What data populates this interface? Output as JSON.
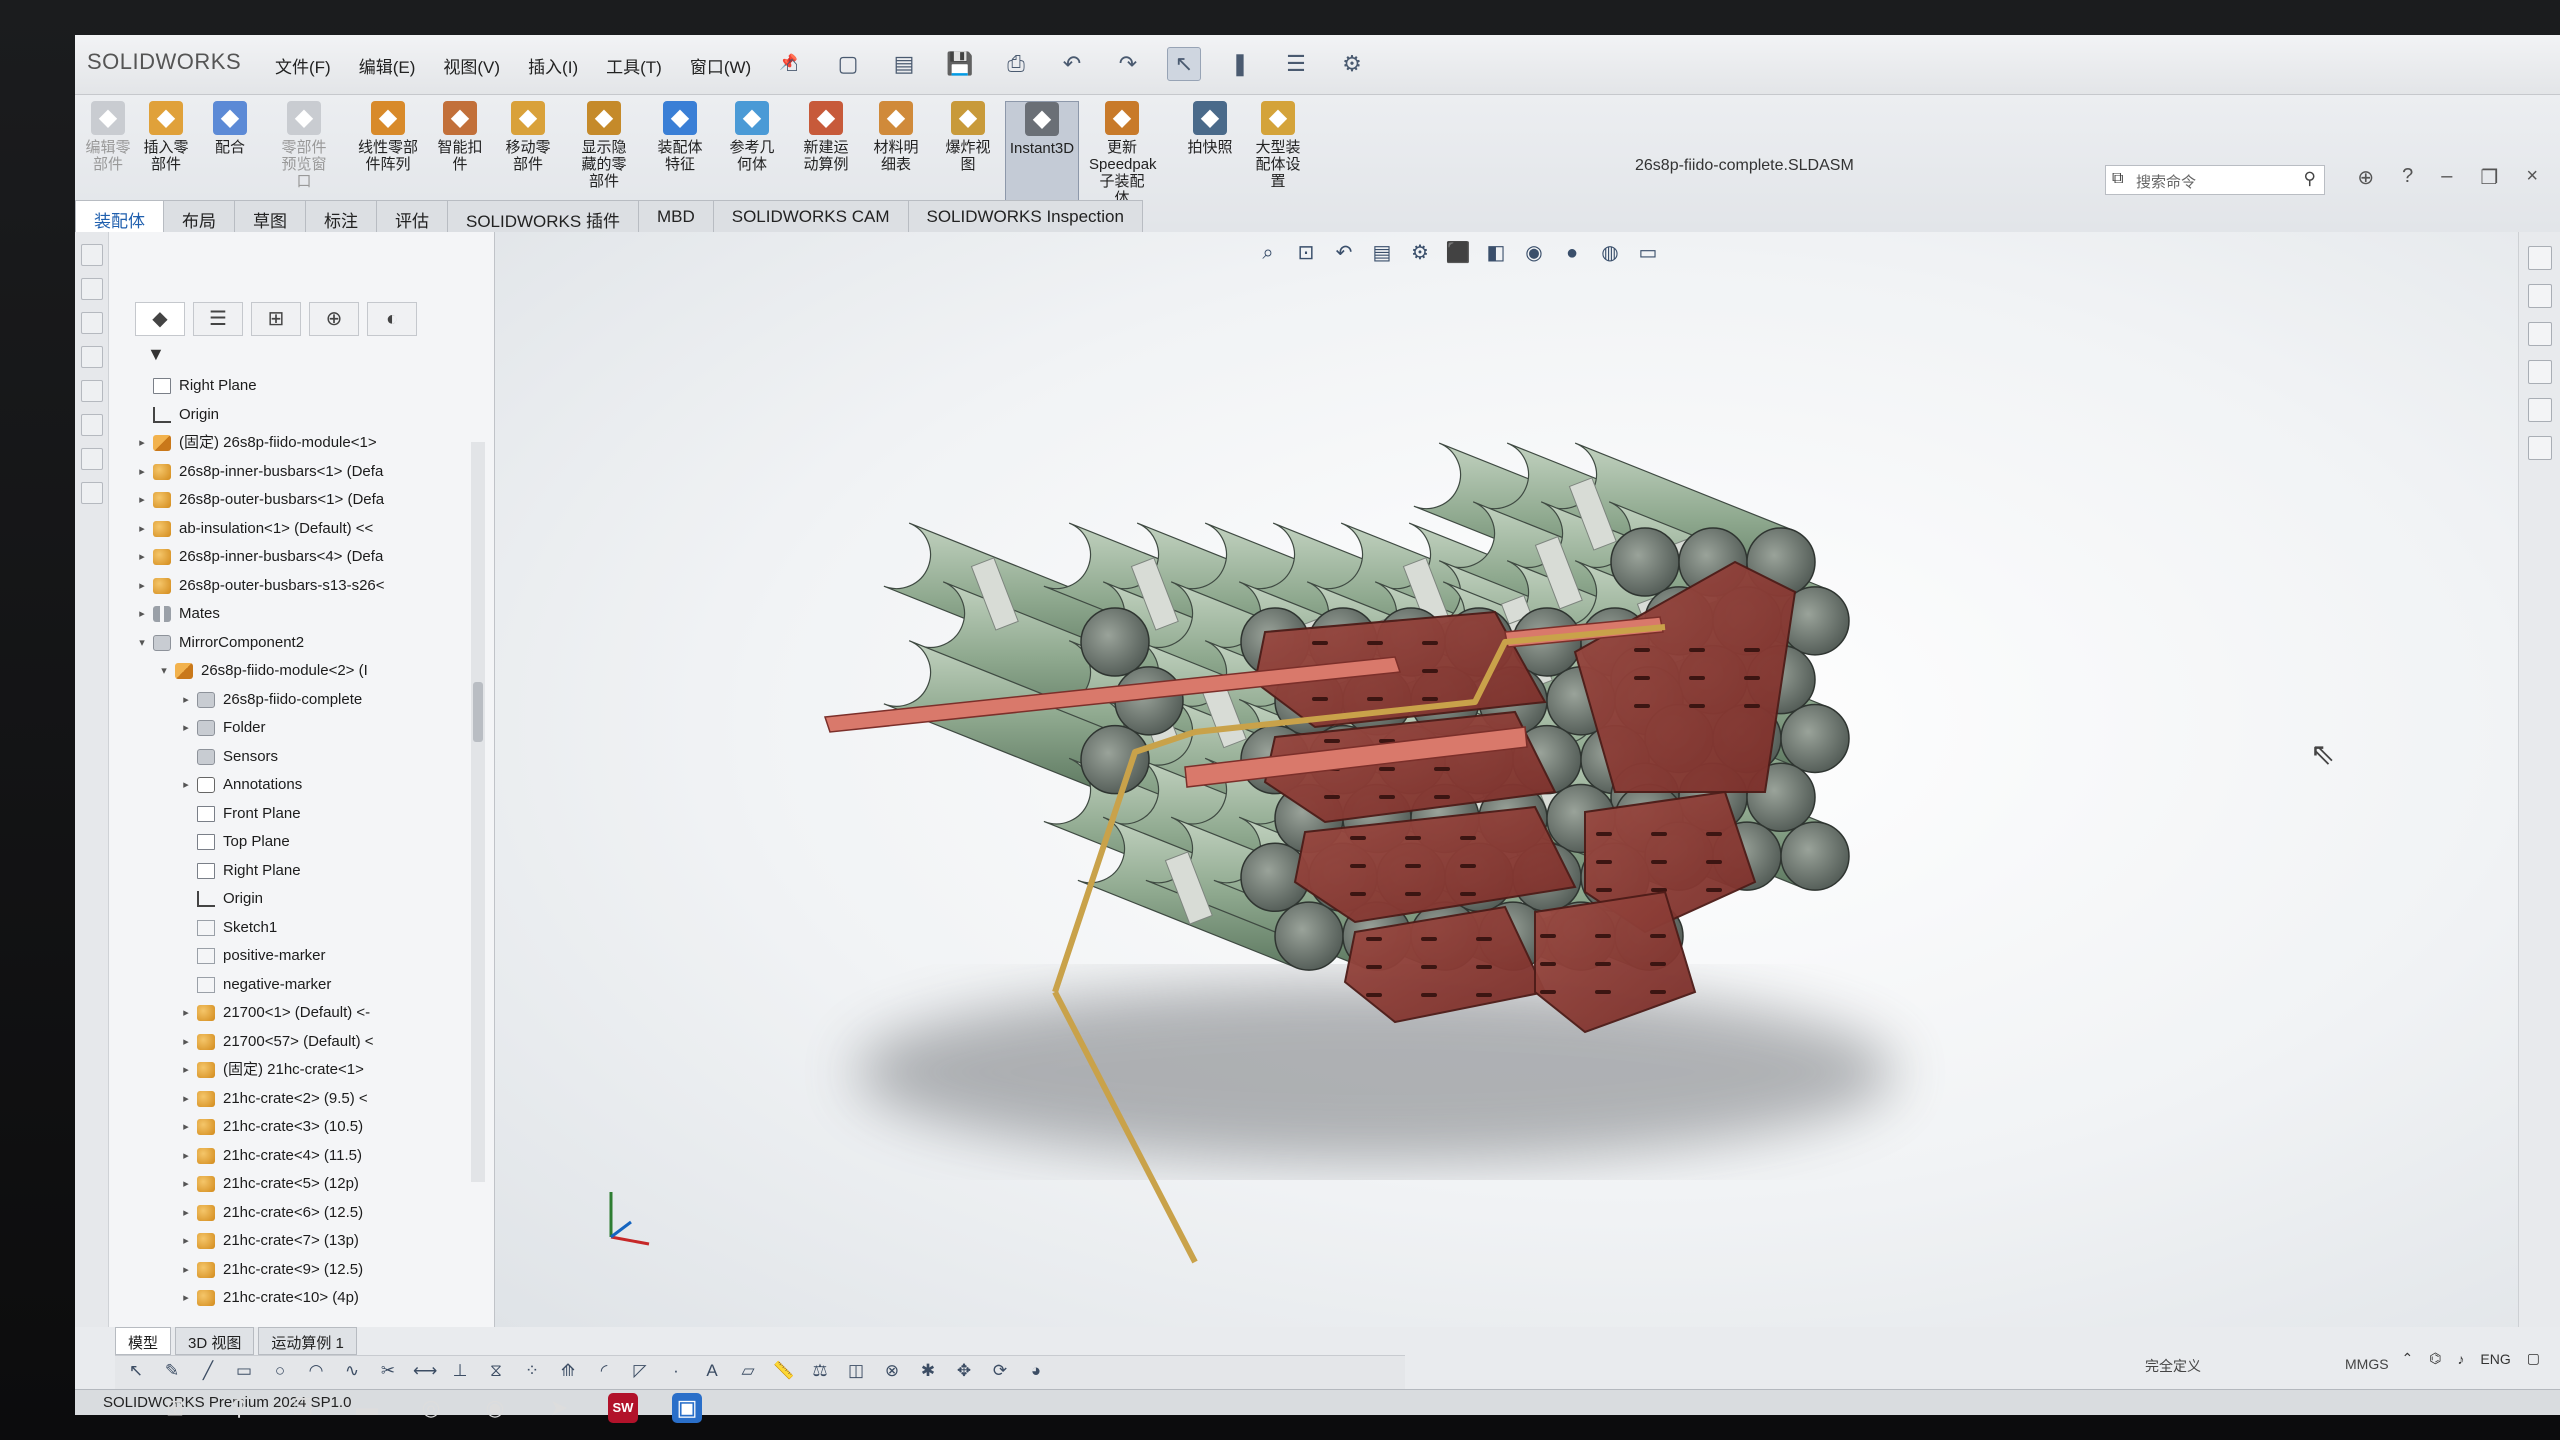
{
  "app": {
    "logo": "SOLIDWORKS",
    "document_title": "26s8p-fiido-complete.SLDASM",
    "version_text": "SOLIDWORKS Premium 2024 SP1.0"
  },
  "menu": [
    "文件(F)",
    "编辑(E)",
    "视图(V)",
    "插入(I)",
    "工具(T)",
    "窗口(W)"
  ],
  "quick_access": [
    "home-icon",
    "new-icon",
    "open-icon",
    "save-icon",
    "print-icon",
    "undo-icon",
    "redo-icon",
    "select-icon",
    "rebuild-icon",
    "file-properties-icon",
    "options-icon"
  ],
  "search": {
    "placeholder": "搜索命令"
  },
  "commands": [
    {
      "label": "编辑零\n部件",
      "dim": true
    },
    {
      "label": "插入零\n部件",
      "dim": false
    },
    {
      "label": "配合",
      "dim": false
    },
    {
      "label": "零部件\n预览窗\n口",
      "dim": true
    },
    {
      "label": "线性零部\n件阵列",
      "dim": false
    },
    {
      "label": "智能扣\n件",
      "dim": false
    },
    {
      "label": "移动零\n部件",
      "dim": false
    },
    {
      "label": "显示隐\n藏的零\n部件",
      "dim": false
    },
    {
      "label": "装配体\n特征",
      "dim": false
    },
    {
      "label": "参考几\n何体",
      "dim": false
    },
    {
      "label": "新建运\n动算例",
      "dim": false
    },
    {
      "label": "材料明\n细表",
      "dim": false
    },
    {
      "label": "爆炸视\n图",
      "dim": false
    },
    {
      "label": "Instant3D",
      "dim": false,
      "active": true
    },
    {
      "label": "更新\nSpeedpak\n子装配\n体",
      "dim": false
    },
    {
      "label": "拍快照",
      "dim": false
    },
    {
      "label": "大型装\n配体设\n置",
      "dim": false
    }
  ],
  "tabs": [
    "装配体",
    "布局",
    "草图",
    "标注",
    "评估",
    "SOLIDWORKS 插件",
    "MBD",
    "SOLIDWORKS CAM",
    "SOLIDWORKS Inspection"
  ],
  "tree": [
    {
      "label": "Right Plane",
      "icon": "plane",
      "level": 0,
      "exp": ""
    },
    {
      "label": "Origin",
      "icon": "origin",
      "level": 0,
      "exp": ""
    },
    {
      "label": "(固定) 26s8p-fiido-module<1>",
      "icon": "asm",
      "level": 0,
      "exp": "▸"
    },
    {
      "label": "26s8p-inner-busbars<1> (Defa",
      "icon": "part",
      "level": 0,
      "exp": "▸"
    },
    {
      "label": "26s8p-outer-busbars<1> (Defa",
      "icon": "part",
      "level": 0,
      "exp": "▸"
    },
    {
      "label": "ab-insulation<1> (Default) <<",
      "icon": "part",
      "level": 0,
      "exp": "▸"
    },
    {
      "label": "26s8p-inner-busbars<4> (Defa",
      "icon": "part",
      "level": 0,
      "exp": "▸"
    },
    {
      "label": "26s8p-outer-busbars-s13-s26<",
      "icon": "part",
      "level": 0,
      "exp": "▸"
    },
    {
      "label": "Mates",
      "icon": "mates",
      "level": 0,
      "exp": "▸"
    },
    {
      "label": "MirrorComponent2",
      "icon": "folder",
      "level": 0,
      "exp": "▾"
    },
    {
      "label": "26s8p-fiido-module<2> (I",
      "icon": "asm",
      "level": 1,
      "exp": "▾"
    },
    {
      "label": "26s8p-fiido-complete",
      "icon": "folder",
      "level": 2,
      "exp": "▸"
    },
    {
      "label": "Folder",
      "icon": "folder",
      "level": 2,
      "exp": "▸"
    },
    {
      "label": "Sensors",
      "icon": "folder",
      "level": 2,
      "exp": ""
    },
    {
      "label": "Annotations",
      "icon": "anno",
      "level": 2,
      "exp": "▸"
    },
    {
      "label": "Front Plane",
      "icon": "plane",
      "level": 2,
      "exp": ""
    },
    {
      "label": "Top Plane",
      "icon": "plane",
      "level": 2,
      "exp": ""
    },
    {
      "label": "Right Plane",
      "icon": "plane",
      "level": 2,
      "exp": ""
    },
    {
      "label": "Origin",
      "icon": "origin",
      "level": 2,
      "exp": ""
    },
    {
      "label": "Sketch1",
      "icon": "sketch",
      "level": 2,
      "exp": ""
    },
    {
      "label": "positive-marker",
      "icon": "sketch",
      "level": 2,
      "exp": ""
    },
    {
      "label": "negative-marker",
      "icon": "sketch",
      "level": 2,
      "exp": ""
    },
    {
      "label": "21700<1> (Default) <-",
      "icon": "part",
      "level": 2,
      "exp": "▸"
    },
    {
      "label": "21700<57> (Default) <",
      "icon": "part",
      "level": 2,
      "exp": "▸"
    },
    {
      "label": "(固定) 21hc-crate<1>",
      "icon": "part",
      "level": 2,
      "exp": "▸"
    },
    {
      "label": "21hc-crate<2> (9.5) <",
      "icon": "part",
      "level": 2,
      "exp": "▸"
    },
    {
      "label": "21hc-crate<3> (10.5)",
      "icon": "part",
      "level": 2,
      "exp": "▸"
    },
    {
      "label": "21hc-crate<4> (11.5)",
      "icon": "part",
      "level": 2,
      "exp": "▸"
    },
    {
      "label": "21hc-crate<5> (12p)",
      "icon": "part",
      "level": 2,
      "exp": "▸"
    },
    {
      "label": "21hc-crate<6> (12.5)",
      "icon": "part",
      "level": 2,
      "exp": "▸"
    },
    {
      "label": "21hc-crate<7> (13p)",
      "icon": "part",
      "level": 2,
      "exp": "▸"
    },
    {
      "label": "21hc-crate<9> (12.5)",
      "icon": "part",
      "level": 2,
      "exp": "▸"
    },
    {
      "label": "21hc-crate<10> (4p)",
      "icon": "part",
      "level": 2,
      "exp": "▸"
    }
  ],
  "sheet_tabs": [
    "模型",
    "3D 视图",
    "运动算例 1"
  ],
  "status": {
    "definition": "完全定义",
    "units": "MMGS",
    "lang": "ENG"
  },
  "colors": {
    "brand": "#c8102e",
    "cell": "#8fa98f",
    "busbar": "#8b3a34",
    "strap": "#c9a24a"
  }
}
